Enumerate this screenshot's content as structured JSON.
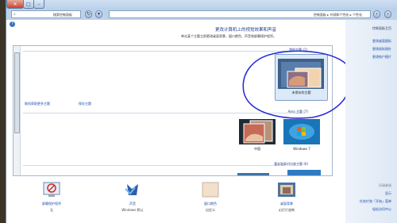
{
  "window": {
    "search_text": "搜索控制面板",
    "path_text": "控制面板 ▸ 外观和个性化 ▸ 个性化",
    "help_icon": "question-icon"
  },
  "page": {
    "title": "更改计算机上的视觉效果和声音",
    "subtitle": "单击某个主题立即更改桌面背景、窗口颜色、声音和屏幕保护程序。"
  },
  "sidebar": {
    "home": "控制面板主页",
    "items": [
      "更改桌面图标",
      "更改鼠标指针",
      "更改帐户图片"
    ],
    "see_also": "另请参阅",
    "links": [
      "显示",
      "任务栏和「开始」菜单",
      "轻松访问中心"
    ]
  },
  "themes": {
    "my_themes": "我的主题 (1)",
    "selected_theme": "未保存的主题",
    "save_theme": "保存主题",
    "get_more": "联机获取更多主题",
    "aero_themes": "Aero 主题 (7)",
    "aero": [
      {
        "label": "Windows 7"
      },
      {
        "label": "中国"
      }
    ],
    "basic_themes": "基本和高对比度主题 (6)"
  },
  "bottom": [
    {
      "name": "桌面背景",
      "value": "幻灯片放映",
      "icon": "desktop-background-icon"
    },
    {
      "name": "窗口颜色",
      "value": "自定义",
      "icon": "window-color-icon"
    },
    {
      "name": "声音",
      "value": "Windows 默认",
      "icon": "sound-icon"
    },
    {
      "name": "屏幕保护程序",
      "value": "无",
      "icon": "screensaver-icon"
    }
  ],
  "colors": {
    "link": "#1e4aa8",
    "title_blue": "#1e3a8a",
    "annotation": "#2a2fd6",
    "close_red": "#c8452c"
  }
}
